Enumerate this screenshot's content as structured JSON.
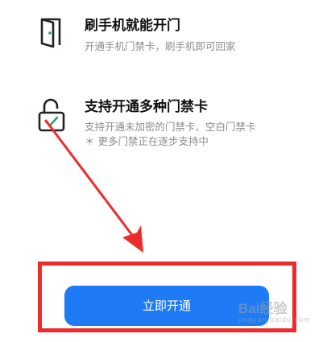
{
  "features": [
    {
      "icon": "door-icon",
      "title": "刷手机就能开门",
      "desc_lines": [
        "开通手机门禁卡，刷手机即可回家"
      ]
    },
    {
      "icon": "unlock-check-icon",
      "title": "支持开通多种门禁卡",
      "desc_lines": [
        "支持开通未加密的门禁卡、空白门禁卡",
        "＊ 更多门禁正在逐步支持中"
      ]
    }
  ],
  "primary_button": {
    "label": "立即开通"
  },
  "colors": {
    "accent": "#1e7bf5",
    "annotation": "#ee2b2b",
    "title_text": "#111111",
    "desc_text": "#8c8c8c",
    "icon_check": "#2aa66b"
  },
  "watermark": {
    "brand": "Bai经验",
    "url": "jingyan.baidu.com"
  }
}
